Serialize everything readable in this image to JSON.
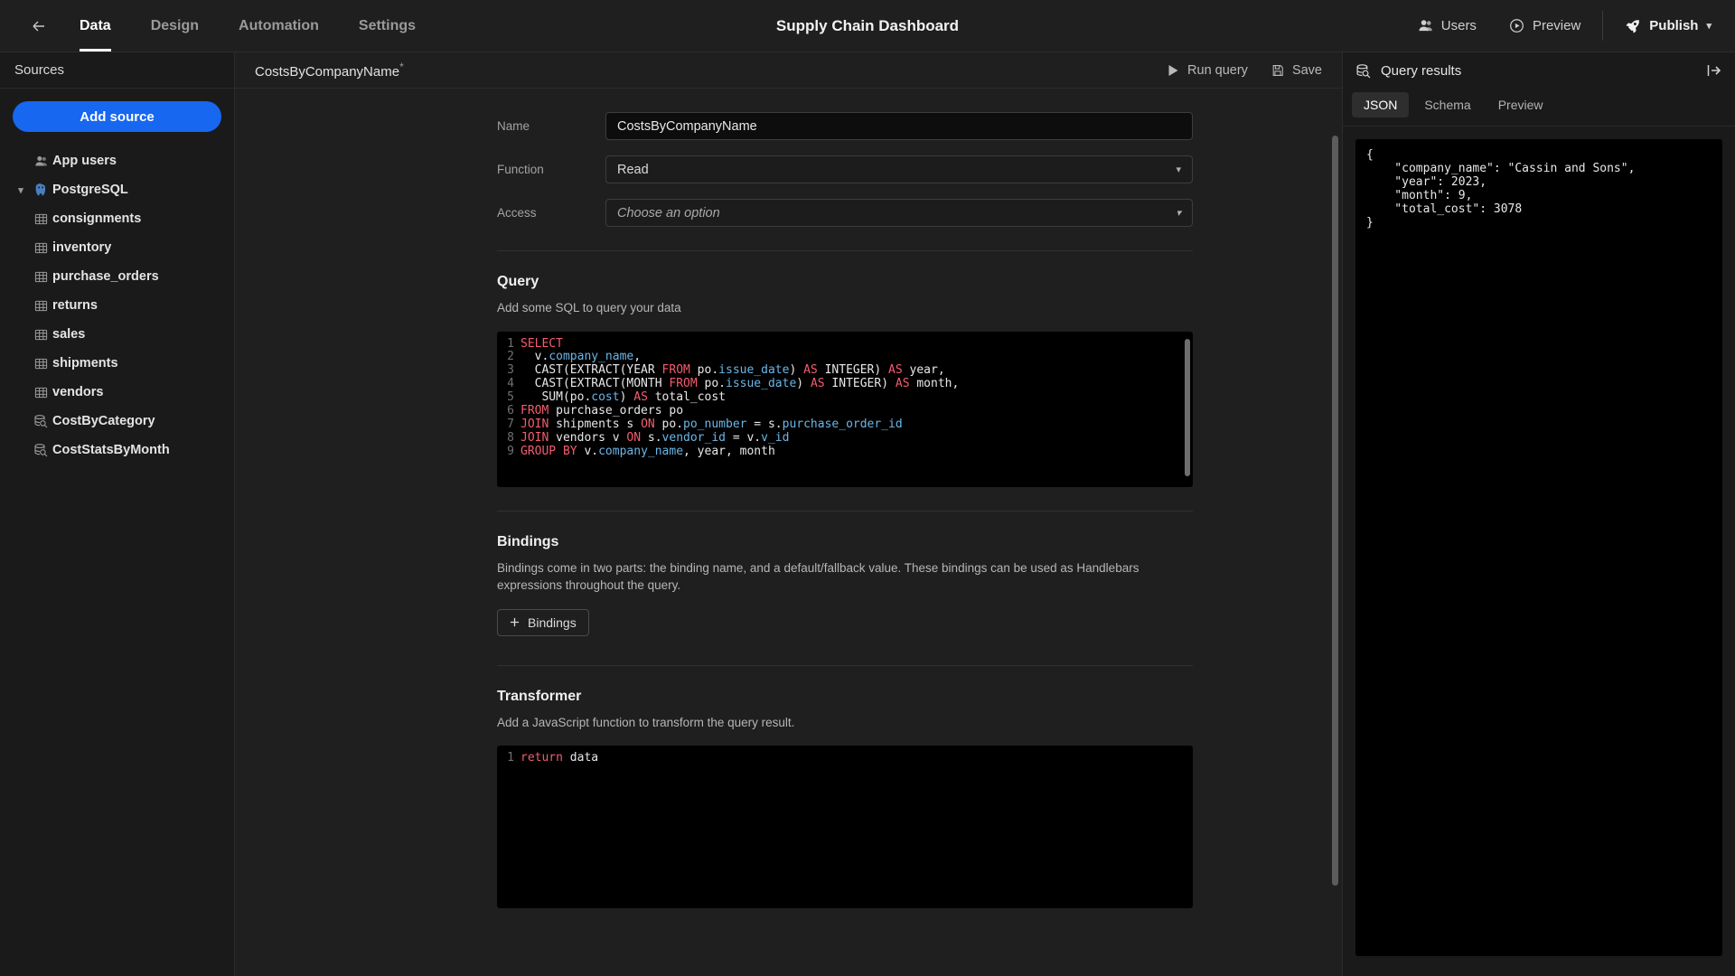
{
  "topbar": {
    "back_icon": "arrow-left-icon",
    "tabs": [
      {
        "label": "Data",
        "active": true
      },
      {
        "label": "Design",
        "active": false
      },
      {
        "label": "Automation",
        "active": false
      },
      {
        "label": "Settings",
        "active": false
      }
    ],
    "title": "Supply Chain Dashboard",
    "users_label": "Users",
    "preview_label": "Preview",
    "publish_label": "Publish"
  },
  "sidebar": {
    "heading": "Sources",
    "add_source_label": "Add source",
    "items": [
      {
        "label": "App users",
        "icon": "users-icon",
        "type": "root",
        "indent": 0
      },
      {
        "label": "PostgreSQL",
        "icon": "postgres-icon",
        "type": "datasource",
        "indent": 0,
        "expanded": true
      },
      {
        "label": "consignments",
        "icon": "table-icon",
        "type": "table",
        "indent": 1
      },
      {
        "label": "inventory",
        "icon": "table-icon",
        "type": "table",
        "indent": 1
      },
      {
        "label": "purchase_orders",
        "icon": "table-icon",
        "type": "table",
        "indent": 1
      },
      {
        "label": "returns",
        "icon": "table-icon",
        "type": "table",
        "indent": 1
      },
      {
        "label": "sales",
        "icon": "table-icon",
        "type": "table",
        "indent": 1
      },
      {
        "label": "shipments",
        "icon": "table-icon",
        "type": "table",
        "indent": 1
      },
      {
        "label": "vendors",
        "icon": "table-icon",
        "type": "table",
        "indent": 1
      },
      {
        "label": "CostByCategory",
        "icon": "query-icon",
        "type": "query",
        "indent": 1
      },
      {
        "label": "CostStatsByMonth",
        "icon": "query-icon",
        "type": "query",
        "indent": 1
      }
    ]
  },
  "main": {
    "doc_title": "CostsByCompanyName",
    "unsaved_marker": "*",
    "run_query_label": "Run query",
    "save_label": "Save",
    "fields": {
      "name_label": "Name",
      "name_value": "CostsByCompanyName",
      "function_label": "Function",
      "function_value": "Read",
      "access_label": "Access",
      "access_placeholder": "Choose an option"
    },
    "query_section": {
      "title": "Query",
      "description": "Add some SQL to query your data",
      "lines": [
        {
          "n": "1",
          "tokens": [
            {
              "t": "SELECT",
              "c": "kw"
            }
          ]
        },
        {
          "n": "2",
          "tokens": [
            {
              "t": "  v.",
              "c": ""
            },
            {
              "t": "company_name",
              "c": "id"
            },
            {
              "t": ",",
              "c": ""
            }
          ]
        },
        {
          "n": "3",
          "tokens": [
            {
              "t": "  CAST(EXTRACT(YEAR ",
              "c": ""
            },
            {
              "t": "FROM",
              "c": "kw"
            },
            {
              "t": " po.",
              "c": ""
            },
            {
              "t": "issue_date",
              "c": "id"
            },
            {
              "t": ") ",
              "c": ""
            },
            {
              "t": "AS",
              "c": "kw"
            },
            {
              "t": " INTEGER) ",
              "c": ""
            },
            {
              "t": "AS",
              "c": "kw"
            },
            {
              "t": " year,",
              "c": ""
            }
          ]
        },
        {
          "n": "4",
          "tokens": [
            {
              "t": "  CAST(EXTRACT(MONTH ",
              "c": ""
            },
            {
              "t": "FROM",
              "c": "kw"
            },
            {
              "t": " po.",
              "c": ""
            },
            {
              "t": "issue_date",
              "c": "id"
            },
            {
              "t": ") ",
              "c": ""
            },
            {
              "t": "AS",
              "c": "kw"
            },
            {
              "t": " INTEGER) ",
              "c": ""
            },
            {
              "t": "AS",
              "c": "kw"
            },
            {
              "t": " month,",
              "c": ""
            }
          ]
        },
        {
          "n": "5",
          "tokens": [
            {
              "t": "   SUM(po.",
              "c": ""
            },
            {
              "t": "cost",
              "c": "id"
            },
            {
              "t": ") ",
              "c": ""
            },
            {
              "t": "AS",
              "c": "kw"
            },
            {
              "t": " total_cost",
              "c": ""
            }
          ]
        },
        {
          "n": "6",
          "tokens": [
            {
              "t": "FROM",
              "c": "kw"
            },
            {
              "t": " purchase_orders po",
              "c": ""
            }
          ]
        },
        {
          "n": "7",
          "tokens": [
            {
              "t": "JOIN",
              "c": "kw"
            },
            {
              "t": " shipments s ",
              "c": ""
            },
            {
              "t": "ON",
              "c": "kw"
            },
            {
              "t": " po.",
              "c": ""
            },
            {
              "t": "po_number",
              "c": "id"
            },
            {
              "t": " = s.",
              "c": ""
            },
            {
              "t": "purchase_order_id",
              "c": "id"
            }
          ]
        },
        {
          "n": "8",
          "tokens": [
            {
              "t": "JOIN",
              "c": "kw"
            },
            {
              "t": " vendors v ",
              "c": ""
            },
            {
              "t": "ON",
              "c": "kw"
            },
            {
              "t": " s.",
              "c": ""
            },
            {
              "t": "vendor_id",
              "c": "id"
            },
            {
              "t": " = v.",
              "c": ""
            },
            {
              "t": "v_id",
              "c": "id"
            }
          ]
        },
        {
          "n": "9",
          "tokens": [
            {
              "t": "GROUP BY",
              "c": "kw"
            },
            {
              "t": " v.",
              "c": ""
            },
            {
              "t": "company_name",
              "c": "id"
            },
            {
              "t": ", year, month",
              "c": ""
            }
          ]
        }
      ]
    },
    "bindings_section": {
      "title": "Bindings",
      "description": "Bindings come in two parts: the binding name, and a default/fallback value. These bindings can be used as Handlebars expressions throughout the query.",
      "button_label": "Bindings",
      "button_icon": "plus-icon"
    },
    "transformer_section": {
      "title": "Transformer",
      "description": "Add a JavaScript function to transform the query result.",
      "lines": [
        {
          "n": "1",
          "tokens": [
            {
              "t": "return",
              "c": "kw"
            },
            {
              "t": " data",
              "c": ""
            }
          ]
        }
      ]
    }
  },
  "results": {
    "title": "Query results",
    "icon": "query-results-icon",
    "expand_icon": "expand-panel-icon",
    "tabs": [
      {
        "label": "JSON",
        "active": true
      },
      {
        "label": "Schema",
        "active": false
      },
      {
        "label": "Preview",
        "active": false
      }
    ],
    "json_text": "{\n    \"company_name\": \"Cassin and Sons\",\n    \"year\": 2023,\n    \"month\": 9,\n    \"total_cost\": 3078\n}"
  },
  "colors": {
    "accent": "#1767f0",
    "bg": "#1a1a1a",
    "panel": "#1f1f1f",
    "code_bg": "#000000",
    "keyword": "#f45c6e",
    "identifier": "#6bb6e8"
  }
}
